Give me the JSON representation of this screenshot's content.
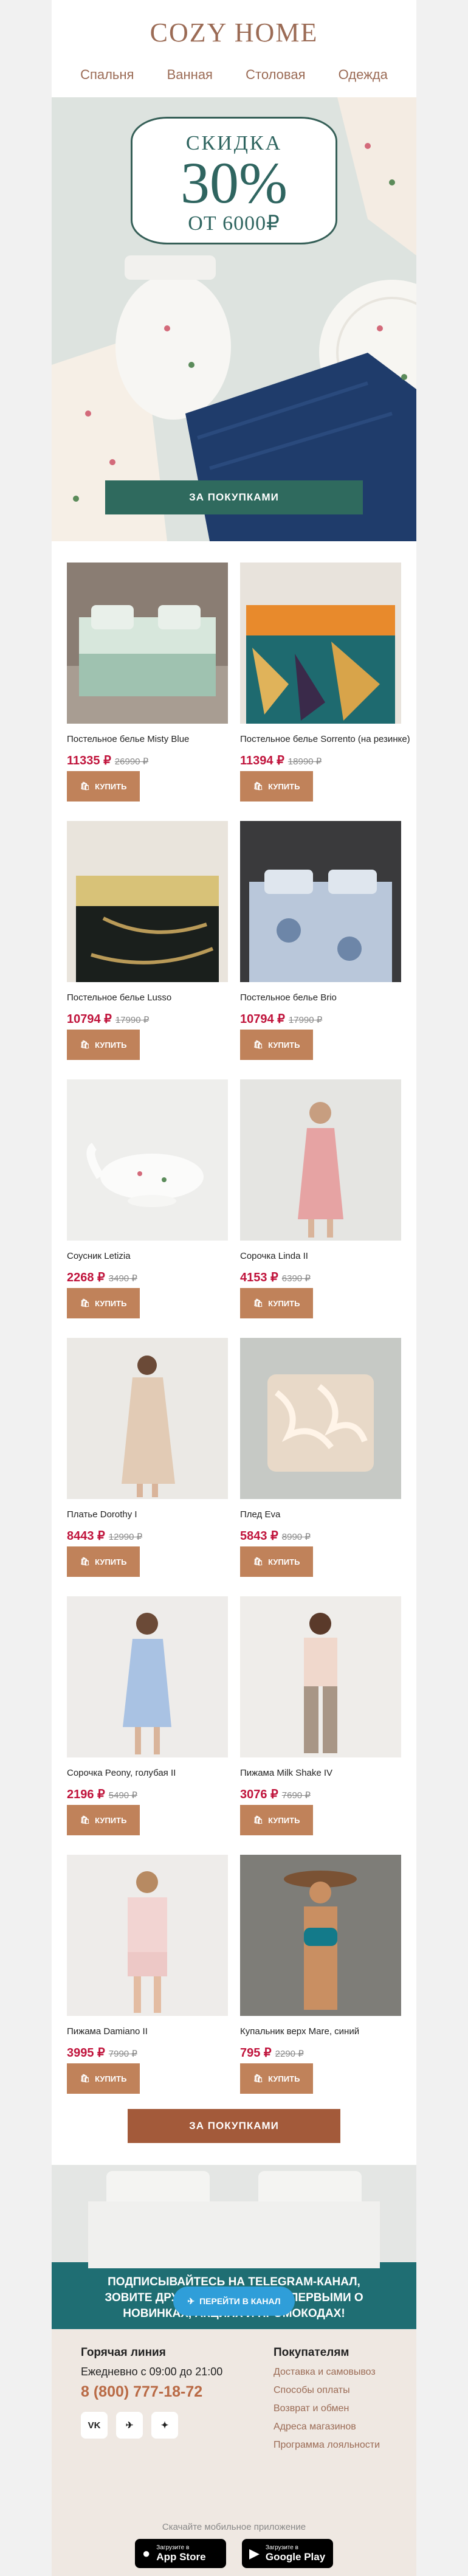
{
  "brand": {
    "logo": "COZY HOME"
  },
  "nav": [
    "Спальня",
    "Ванная",
    "Столовая",
    "Одежда"
  ],
  "hero": {
    "line1": "СКИДКА",
    "line2": "30%",
    "line3": "ОТ 6000₽",
    "cta": "ЗА ПОКУПКАМИ"
  },
  "products": [
    {
      "name": "Постельное белье Misty Blue",
      "price": "11335 ₽",
      "old": "26990 ₽",
      "buy": "КУПИТЬ"
    },
    {
      "name": "Постельное белье Sorrento (на резинке)",
      "price": "11394 ₽",
      "old": "18990 ₽",
      "buy": "КУПИТЬ"
    },
    {
      "name": "Постельное белье Lusso",
      "price": "10794 ₽",
      "old": "17990 ₽",
      "buy": "КУПИТЬ"
    },
    {
      "name": "Постельное белье Brio",
      "price": "10794 ₽",
      "old": "17990 ₽",
      "buy": "КУПИТЬ"
    },
    {
      "name": "Соусник Letizia",
      "price": "2268 ₽",
      "old": "3490 ₽",
      "buy": "КУПИТЬ"
    },
    {
      "name": "Сорочка Linda II",
      "price": "4153 ₽",
      "old": "6390 ₽",
      "buy": "КУПИТЬ"
    },
    {
      "name": "Платье Dorothy I",
      "price": "8443 ₽",
      "old": "12990 ₽",
      "buy": "КУПИТЬ"
    },
    {
      "name": "Плед Eva",
      "price": "5843 ₽",
      "old": "8990 ₽",
      "buy": "КУПИТЬ"
    },
    {
      "name": "Сорочка Peony, голубая II",
      "price": "2196 ₽",
      "old": "5490 ₽",
      "buy": "КУПИТЬ"
    },
    {
      "name": "Пижама Milk Shake IV",
      "price": "3076 ₽",
      "old": "7690 ₽",
      "buy": "КУПИТЬ"
    },
    {
      "name": "Пижама Damiano II",
      "price": "3995 ₽",
      "old": "7990 ₽",
      "buy": "КУПИТЬ"
    },
    {
      "name": "Купальник верх Mare, синий",
      "price": "795 ₽",
      "old": "2290 ₽",
      "buy": "КУПИТЬ"
    }
  ],
  "bottom_cta": "ЗА ПОКУПКАМИ",
  "telegram": {
    "line1": "ПОДПИСЫВАЙТЕСЬ НА TELEGRAM-КАНАЛ,",
    "line2": "ЗОВИТЕ ДРУЗЕЙ И УЗНАВАЙТЕ ПЕРВЫМИ О",
    "line3": "НОВИНКАХ, АКЦИЯХ И ПРОМОКОДАХ!",
    "button": "ПЕРЕЙТИ В КАНАЛ"
  },
  "footer": {
    "hotline_title": "Горячая линия",
    "hours": "Ежедневно с 09:00 до 21:00",
    "phone": "8 (800) 777-18-72",
    "buyers_title": "Покупателям",
    "links": [
      "Доставка и самовывоз",
      "Способы оплаты",
      "Возврат и обмен",
      "Адреса магазинов",
      "Программа лояльности"
    ],
    "social": [
      "VK",
      "✈",
      "✦"
    ],
    "apps_title": "Скачайте мобильное приложение",
    "appstore_small": "Загрузите в",
    "appstore": "App Store",
    "googleplay_small": "Загрузите в",
    "googleplay": "Google Play"
  },
  "colors": {
    "accent": "#9b6b55",
    "price": "#c0143c",
    "buy": "#c0825a",
    "hero_button": "#2f6a5e",
    "telegram": "#2f9ed9"
  }
}
